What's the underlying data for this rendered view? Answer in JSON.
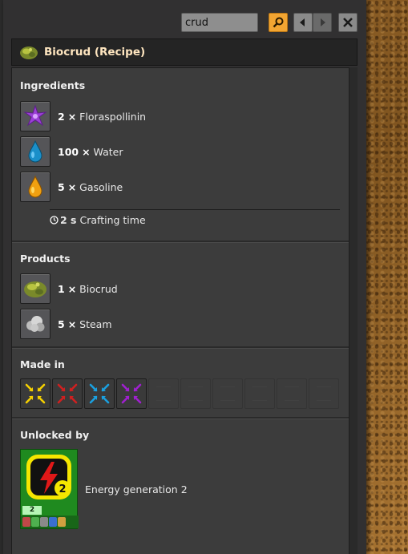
{
  "search": {
    "value": "crud"
  },
  "toolbar": {
    "search_button": "search",
    "back_button": "back",
    "forward_button": "forward",
    "close_button": "close"
  },
  "title": "Biocrud (Recipe)",
  "ingredients": {
    "heading": "Ingredients",
    "items": [
      {
        "count": "2",
        "times": "×",
        "name": "Floraspollinin",
        "icon": "floraspollinin-icon"
      },
      {
        "count": "100",
        "times": "×",
        "name": "Water",
        "icon": "water-icon"
      },
      {
        "count": "5",
        "times": "×",
        "name": "Gasoline",
        "icon": "gasoline-icon"
      }
    ],
    "crafting_time": {
      "value": "2 s",
      "label": "Crafting time"
    }
  },
  "products": {
    "heading": "Products",
    "items": [
      {
        "count": "1",
        "times": "×",
        "name": "Biocrud",
        "icon": "biocrud-icon"
      },
      {
        "count": "5",
        "times": "×",
        "name": "Steam",
        "icon": "steam-icon"
      }
    ]
  },
  "made_in": {
    "heading": "Made in",
    "machines": [
      {
        "icon": "assembler-yellow-icon",
        "color": "#f5d000"
      },
      {
        "icon": "assembler-red-icon",
        "color": "#d02020"
      },
      {
        "icon": "assembler-blue-icon",
        "color": "#1aa0e0"
      },
      {
        "icon": "assembler-purple-icon",
        "color": "#a020d0"
      }
    ]
  },
  "unlocked_by": {
    "heading": "Unlocked by",
    "technology": {
      "name": "Energy generation 2",
      "level": "2",
      "icon": "energy-generation-icon"
    }
  },
  "colors": {
    "accent": "#f2a532",
    "title_text": "#ffe6c0",
    "tech_green": "#1f8a1f"
  }
}
